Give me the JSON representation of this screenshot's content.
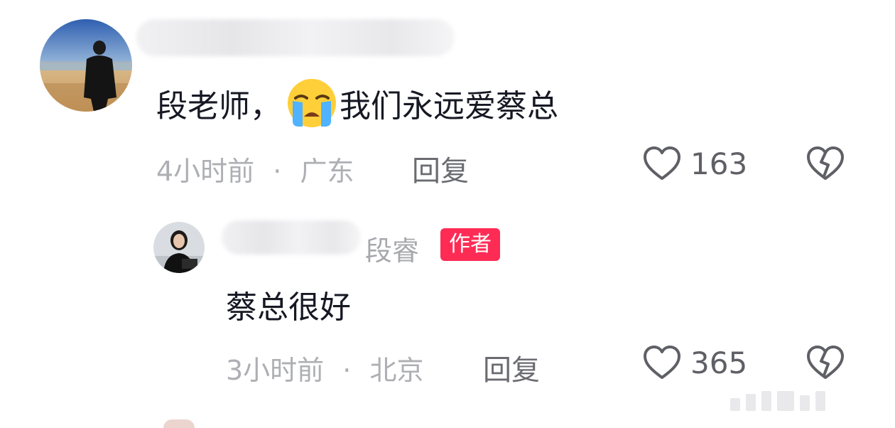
{
  "comments": [
    {
      "name_partial": "",
      "text_before_emoji": "段老师，",
      "emoji": "loudly-crying-face",
      "text_after_emoji": "我们永远爱蔡总",
      "time": "4小时前",
      "dot": "·",
      "location": "广东",
      "reply_label": "回复",
      "likes": "163"
    }
  ],
  "reply": {
    "name_partial": "",
    "name": "段睿",
    "badge": "作者",
    "text": "蔡总很好",
    "time": "3小时前",
    "dot": "·",
    "location": "北京",
    "reply_label": "回复",
    "likes": "365"
  },
  "colors": {
    "badge_bg": "#fe2c55",
    "text_primary": "#161823",
    "text_meta": "#aeafb4",
    "icon": "#5f6066"
  }
}
